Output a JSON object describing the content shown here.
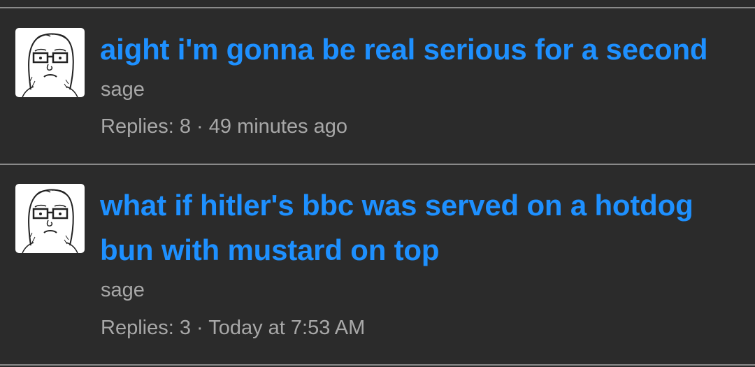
{
  "threads": [
    {
      "title": "aight i'm gonna be real serious for a second",
      "author": "sage",
      "replies_label": "Replies: 8",
      "separator": " · ",
      "timestamp": "49 minutes ago",
      "avatar_icon": "wojak-glasses-icon"
    },
    {
      "title": "what if hitler's bbc was served on a hotdog bun with mustard on top",
      "author": "sage",
      "replies_label": "Replies: 3",
      "separator": " · ",
      "timestamp": "Today at 7:53 AM",
      "avatar_icon": "wojak-glasses-icon"
    }
  ],
  "colors": {
    "background": "#2b2b2b",
    "title": "#1e90ff",
    "meta": "#a8a8a8",
    "divider": "#8a8a8a"
  }
}
